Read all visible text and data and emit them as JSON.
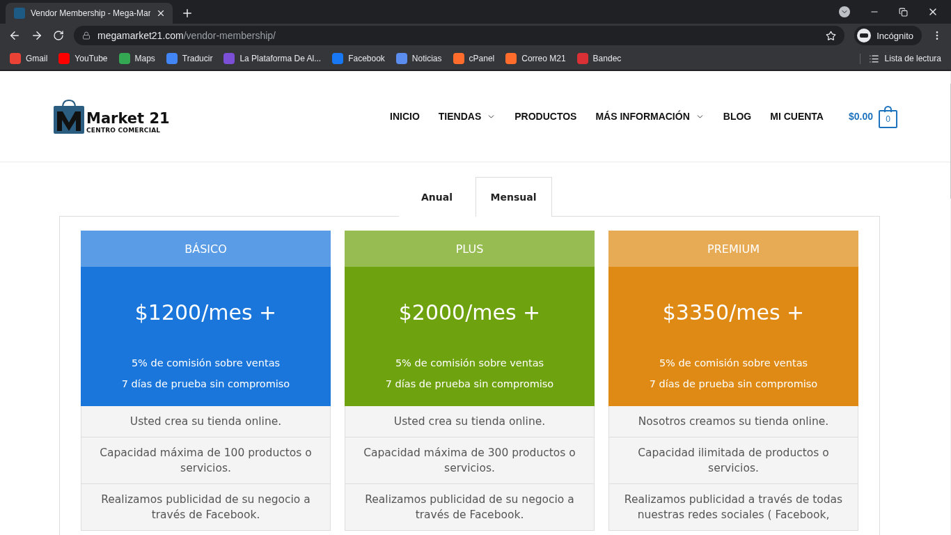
{
  "browser": {
    "tab_title": "Vendor Membership - Mega-Mar",
    "url_host": "megamarket21.com",
    "url_path": "/vendor-membership/",
    "profile": "Incógnito",
    "bookmarks": [
      {
        "label": "Gmail",
        "color": "#ea4335"
      },
      {
        "label": "YouTube",
        "color": "#ff0000"
      },
      {
        "label": "Maps",
        "color": "#34a853"
      },
      {
        "label": "Traducir",
        "color": "#4285f4"
      },
      {
        "label": "La Plataforma De Al...",
        "color": "#7b4fd6"
      },
      {
        "label": "Facebook",
        "color": "#1877f2"
      },
      {
        "label": "Noticias",
        "color": "#5b8def"
      },
      {
        "label": "cPanel",
        "color": "#ff6c2c"
      },
      {
        "label": "Correo M21",
        "color": "#ff6c2c"
      },
      {
        "label": "Bandec",
        "color": "#d93036"
      }
    ],
    "reading_list": "Lista de lectura"
  },
  "site": {
    "logo": {
      "name": "Market 21",
      "tagline": "CENTRO COMERCIAL"
    },
    "nav": [
      {
        "label": "INICIO",
        "dropdown": false
      },
      {
        "label": "TIENDAS",
        "dropdown": true
      },
      {
        "label": "PRODUCTOS",
        "dropdown": false
      },
      {
        "label": "MÁS INFORMACIÓN",
        "dropdown": true
      },
      {
        "label": "BLOG",
        "dropdown": false
      },
      {
        "label": "MI CUENTA",
        "dropdown": false
      }
    ],
    "cart": {
      "total": "$0.00",
      "count": "0"
    }
  },
  "billing_tabs": [
    {
      "label": "Anual",
      "selected": false
    },
    {
      "label": "Mensual",
      "selected": true
    }
  ],
  "plans": [
    {
      "name": "BÁSICO",
      "color": "#1a76db",
      "price": "$1200/mes +",
      "notes": [
        "5% de comisión sobre ventas",
        "7 días de prueba sin compromiso"
      ],
      "features": [
        "Usted crea su tienda online.",
        "Capacidad máxima de 100 productos o servicios.",
        "Realizamos publicidad de su negocio a través de Facebook."
      ]
    },
    {
      "name": "PLUS",
      "color": "#6fa20f",
      "price": "$2000/mes +",
      "notes": [
        "5% de comisión sobre ventas",
        "7 días de prueba sin compromiso"
      ],
      "features": [
        "Usted crea su tienda online.",
        "Capacidad máxima de 300 productos o servicios.",
        "Realizamos publicidad de su negocio a través de Facebook."
      ]
    },
    {
      "name": "PREMIUM",
      "color": "#de8a14",
      "price": "$3350/mes +",
      "notes": [
        "5% de comisión sobre ventas",
        "7 días de prueba sin compromiso"
      ],
      "features": [
        "Nosotros creamos su tienda online.",
        "Capacidad ilimitada de productos o servicios.",
        "Realizamos publicidad a través de todas nuestras redes sociales ( Facebook,"
      ]
    }
  ]
}
